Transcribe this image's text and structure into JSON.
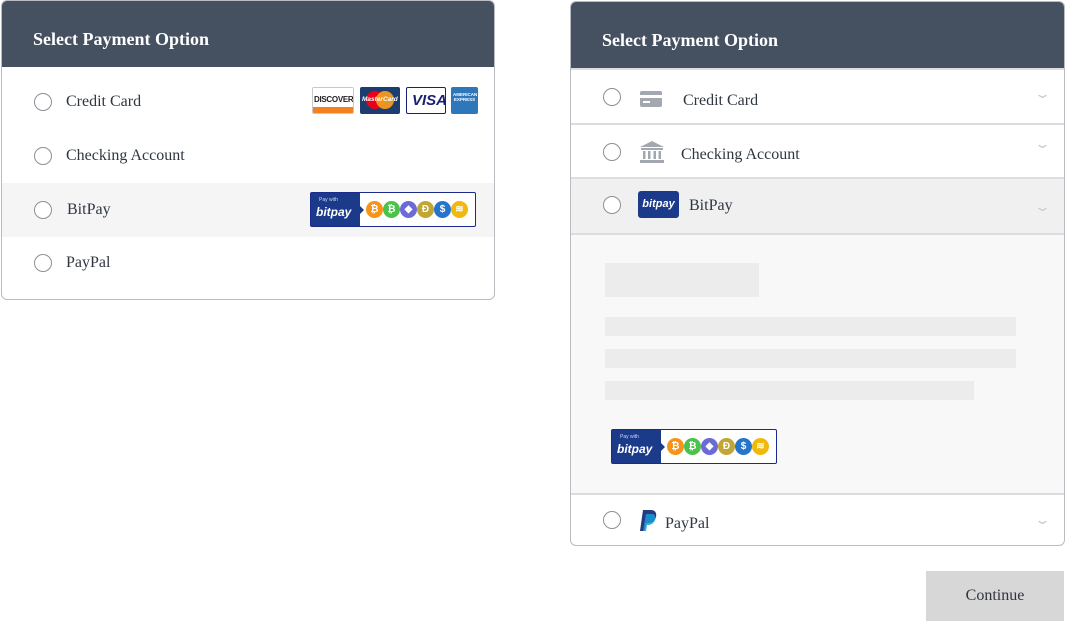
{
  "left_panel": {
    "title": "Select Payment Option",
    "options": [
      {
        "label": "Credit Card"
      },
      {
        "label": "Checking Account"
      },
      {
        "label": "BitPay"
      },
      {
        "label": "PayPal"
      }
    ],
    "card_logos": {
      "discover": "DISCOVER",
      "mastercard": "MasterCard",
      "visa": "VISA",
      "amex": "AMERICAN EXPRESS"
    }
  },
  "right_panel": {
    "title": "Select Payment Option",
    "options": [
      {
        "label": "Credit Card",
        "icon": "credit-card-icon"
      },
      {
        "label": "Checking Account",
        "icon": "bank-icon"
      },
      {
        "label": "BitPay",
        "icon": "bitpay-logo-icon",
        "expanded": true
      },
      {
        "label": "PayPal",
        "icon": "paypal-icon"
      }
    ],
    "bitpay_logo_text": "bitpay"
  },
  "bitpay_badge": {
    "small_text": "Pay with",
    "brand": "bitpay",
    "coins": [
      {
        "name": "bitcoin-icon",
        "symbol": "₿",
        "color": "#f7931a"
      },
      {
        "name": "bitcoin-cash-icon",
        "symbol": "₿",
        "color": "#4bc34b"
      },
      {
        "name": "ethereum-icon",
        "symbol": "◆",
        "color": "#6c6bd6"
      },
      {
        "name": "dogecoin-icon",
        "symbol": "Ð",
        "color": "#c2a633"
      },
      {
        "name": "usdc-icon",
        "symbol": "$",
        "color": "#2775ca"
      },
      {
        "name": "busd-icon",
        "symbol": "≋",
        "color": "#f0b90b"
      }
    ]
  },
  "continue_label": "Continue",
  "colors": {
    "header_bg": "#455060",
    "highlight_row": "#f5f5f6",
    "bitpay_blue": "#1b3a8a",
    "button_bg": "#d7d7d8"
  }
}
